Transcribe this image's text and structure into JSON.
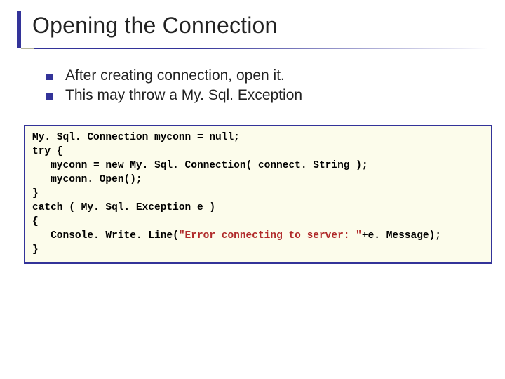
{
  "title": "Opening the Connection",
  "bullets": [
    "After creating connection, open it.",
    "This may throw a My. Sql. Exception"
  ],
  "code": {
    "l1": "My. Sql. Connection myconn = null;",
    "l2": "try {",
    "l3": "   myconn = new My. Sql. Connection( connect. String );",
    "l4": "   myconn. Open();",
    "l5": "}",
    "l6": "catch ( My. Sql. Exception e )",
    "l7": "{",
    "l8a": "   Console. Write. Line(",
    "l8s": "\"Error connecting to server: \"",
    "l8b": "+e. Message);",
    "l9": "}"
  }
}
